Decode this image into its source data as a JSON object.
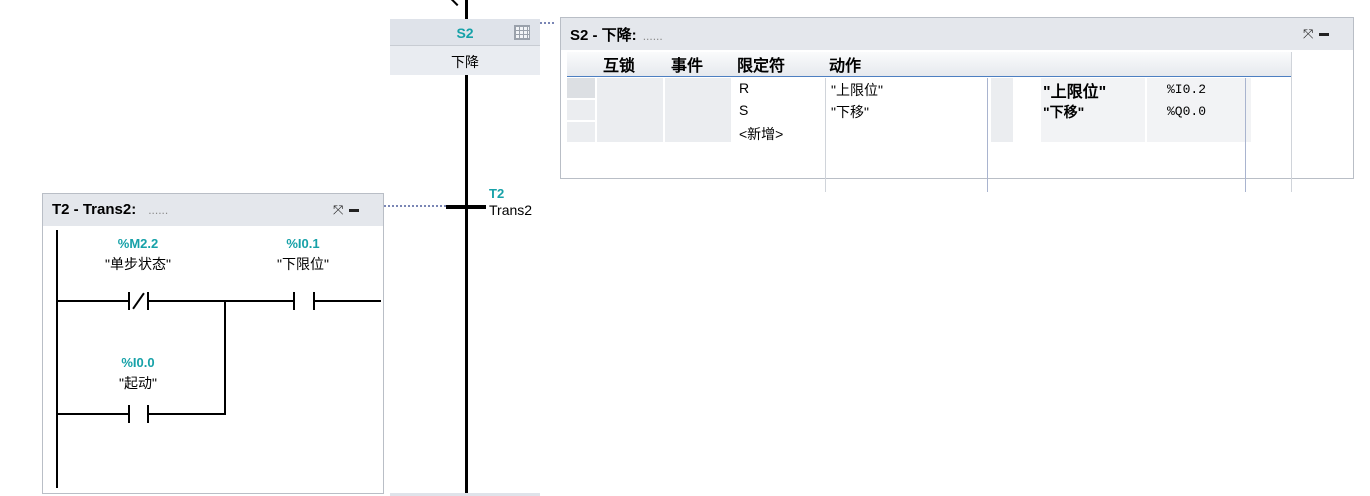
{
  "sequence": {
    "step": {
      "number": "S2",
      "name": "下降"
    },
    "transition": {
      "number": "T2",
      "name": "Trans2"
    }
  },
  "step_panel": {
    "title": "S2 - 下降:",
    "comment_placeholder": "......",
    "columns": [
      "互锁",
      "事件",
      "限定符",
      "动作"
    ],
    "rows": [
      {
        "qualifier": "R",
        "action": "\"上限位\"",
        "operand_name": "\"上限位\"",
        "operand_addr": "%I0.2"
      },
      {
        "qualifier": "S",
        "action": "\"下移\"",
        "operand_name": "\"下移\"",
        "operand_addr": "%Q0.0"
      },
      {
        "qualifier": "<新增>",
        "action": "",
        "operand_name": "",
        "operand_addr": ""
      }
    ]
  },
  "trans_panel": {
    "title": "T2 - Trans2:",
    "comment_placeholder": "......",
    "contacts": [
      {
        "addr": "%M2.2",
        "name": "\"单步状态\"",
        "type": "NC"
      },
      {
        "addr": "%I0.1",
        "name": "\"下限位\"",
        "type": "NO"
      },
      {
        "addr": "%I0.0",
        "name": "\"起动\"",
        "type": "NO"
      }
    ]
  },
  "colors": {
    "accent": "#16a1a8",
    "header": "#e4e7ec",
    "link": "#7a86b5"
  }
}
